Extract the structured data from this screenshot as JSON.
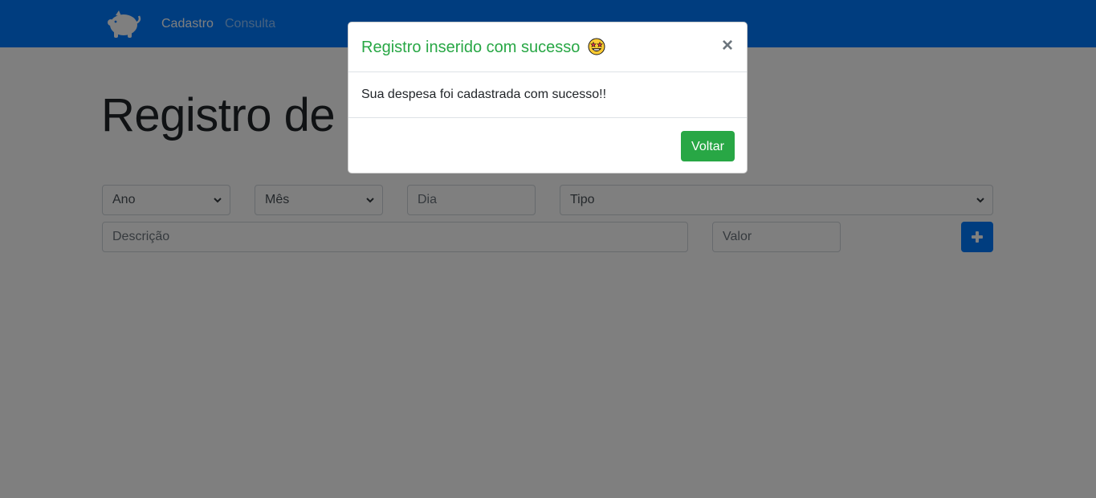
{
  "nav": {
    "logo_icon": "piggy-bank-icon",
    "links": [
      "Cadastro",
      "Consulta"
    ]
  },
  "main": {
    "title": "Registro de n",
    "fields": {
      "ano": "Ano",
      "mes": "Mês",
      "dia_placeholder": "Dia",
      "tipo": "Tipo",
      "descricao_placeholder": "Descrição",
      "valor_placeholder": "Valor"
    },
    "add_button_icon": "plus-icon"
  },
  "modal": {
    "title": "Registro inserido com sucesso",
    "title_emoji_icon": "star-struck-emoji-icon",
    "close_label": "×",
    "body": "Sua despesa foi cadastrada com sucesso!!",
    "button_label": "Voltar"
  },
  "colors": {
    "navbar": "#007bff",
    "success": "#28a745",
    "primary": "#007bff"
  }
}
